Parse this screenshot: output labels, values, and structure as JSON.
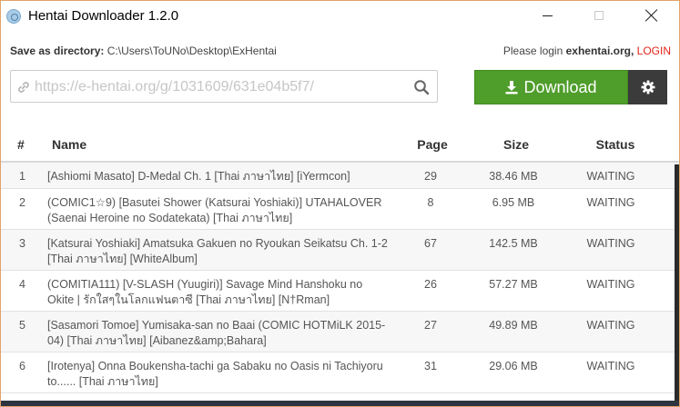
{
  "window": {
    "title": "Hentai Downloader 1.2.0"
  },
  "header": {
    "save_label": "Save as directory:",
    "save_path": "C:\\Users\\ToUNo\\Desktop\\ExHentai",
    "login_prefix": "Please login",
    "login_site": "exhentai.org,",
    "login_link": "LOGIN"
  },
  "url": {
    "placeholder": "https://e-hentai.org/g/1031609/631e04b5f7/",
    "value": ""
  },
  "actions": {
    "download_label": "Download"
  },
  "table": {
    "columns": {
      "num": "#",
      "name": "Name",
      "page": "Page",
      "size": "Size",
      "status": "Status"
    },
    "rows": [
      {
        "num": "1",
        "name": "[Ashiomi Masato] D-Medal Ch. 1 [Thai ภาษาไทย] [iYermcon]",
        "page": "29",
        "size": "38.46 MB",
        "status": "WAITING"
      },
      {
        "num": "2",
        "name": "(COMIC1☆9) [Basutei Shower (Katsurai Yoshiaki)] UTAHALOVER (Saenai Heroine no Sodatekata) [Thai ภาษาไทย]",
        "page": "8",
        "size": "6.95 MB",
        "status": "WAITING"
      },
      {
        "num": "3",
        "name": "[Katsurai Yoshiaki] Amatsuka Gakuen no Ryoukan Seikatsu Ch. 1-2 [Thai ภาษาไทย] [WhiteAlbum]",
        "page": "67",
        "size": "142.5 MB",
        "status": "WAITING"
      },
      {
        "num": "4",
        "name": "(COMITIA111) [V-SLASH (Yuugiri)] Savage Mind Hanshoku no Okite | รักใสๆในโลกแฟนตาซี [Thai ภาษาไทย] [N†Rman]",
        "page": "26",
        "size": "57.27 MB",
        "status": "WAITING"
      },
      {
        "num": "5",
        "name": "[Sasamori Tomoe] Yumisaka-san no Baai (COMIC HOTMiLK 2015-04) [Thai ภาษาไทย] [Aibanez&amp;Bahara]",
        "page": "27",
        "size": "49.89 MB",
        "status": "WAITING"
      },
      {
        "num": "6",
        "name": "[Irotenya] Onna Boukensha-tachi ga Sabaku no Oasis ni Tachiyoru to...... [Thai ภาษาไทย]",
        "page": "31",
        "size": "29.06 MB",
        "status": "WAITING"
      }
    ]
  },
  "colors": {
    "download": "#4f9d2a",
    "settings": "#3b3b3b",
    "login_link": "#e2231a"
  }
}
